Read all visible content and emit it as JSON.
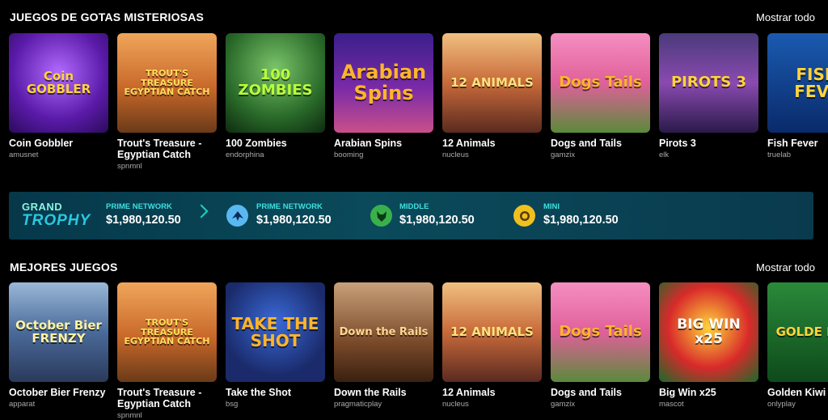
{
  "sections": [
    {
      "title": "JUEGOS DE GOTAS MISTERIOSAS",
      "show_all": "Mostrar todo",
      "games": [
        {
          "name": "Coin Gobbler",
          "provider": "amusnet",
          "thumb_text": "Coin GOBBLER"
        },
        {
          "name": "Trout's Treasure - Egyptian Catch",
          "provider": "spnmnl",
          "thumb_text": "TROUT'S TREASURE EGYPTIAN CATCH"
        },
        {
          "name": "100 Zombies",
          "provider": "endorphina",
          "thumb_text": "100 ZOMBIES"
        },
        {
          "name": "Arabian Spins",
          "provider": "booming",
          "thumb_text": "Arabian Spins"
        },
        {
          "name": "12 Animals",
          "provider": "nucleus",
          "thumb_text": "12 ANIMALS"
        },
        {
          "name": "Dogs and Tails",
          "provider": "gamzix",
          "thumb_text": "Dogs Tails"
        },
        {
          "name": "Pirots 3",
          "provider": "elk",
          "thumb_text": "PIROTS 3"
        },
        {
          "name": "Fish Fever",
          "provider": "truelab",
          "thumb_text": "FISH FEVE"
        }
      ]
    },
    {
      "title": "MEJORES JUEGOS",
      "show_all": "Mostrar todo",
      "games": [
        {
          "name": "October Bier Frenzy",
          "provider": "apparat",
          "thumb_text": "October Bier FRENZY"
        },
        {
          "name": "Trout's Treasure - Egyptian Catch",
          "provider": "spnmnl",
          "thumb_text": "TROUT'S TREASURE EGYPTIAN CATCH"
        },
        {
          "name": "Take the Shot",
          "provider": "bsg",
          "thumb_text": "TAKE THE SHOT"
        },
        {
          "name": "Down the Rails",
          "provider": "pragmaticplay",
          "thumb_text": "Down the Rails"
        },
        {
          "name": "12 Animals",
          "provider": "nucleus",
          "thumb_text": "12 ANIMALS"
        },
        {
          "name": "Dogs and Tails",
          "provider": "gamzix",
          "thumb_text": "Dogs Tails"
        },
        {
          "name": "Big Win x25",
          "provider": "mascot",
          "thumb_text": "BIG WIN x25"
        },
        {
          "name": "Golden Kiwi",
          "provider": "onlyplay",
          "thumb_text": "GOLDE KIWI"
        }
      ]
    }
  ],
  "jackpot": {
    "grand_line1": "GRAND",
    "grand_line2": "TROPHY",
    "tiers": [
      {
        "label": "PRIME NETWORK",
        "value": "$1,980,120.50",
        "icon": "none"
      },
      {
        "label": "PRIME NETWORK",
        "value": "$1,980,120.50",
        "icon": "eagle-icon"
      },
      {
        "label": "MIDDLE",
        "value": "$1,980,120.50",
        "icon": "wolf-icon"
      },
      {
        "label": "MINI",
        "value": "$1,980,120.50",
        "icon": "lion-icon"
      }
    ]
  }
}
